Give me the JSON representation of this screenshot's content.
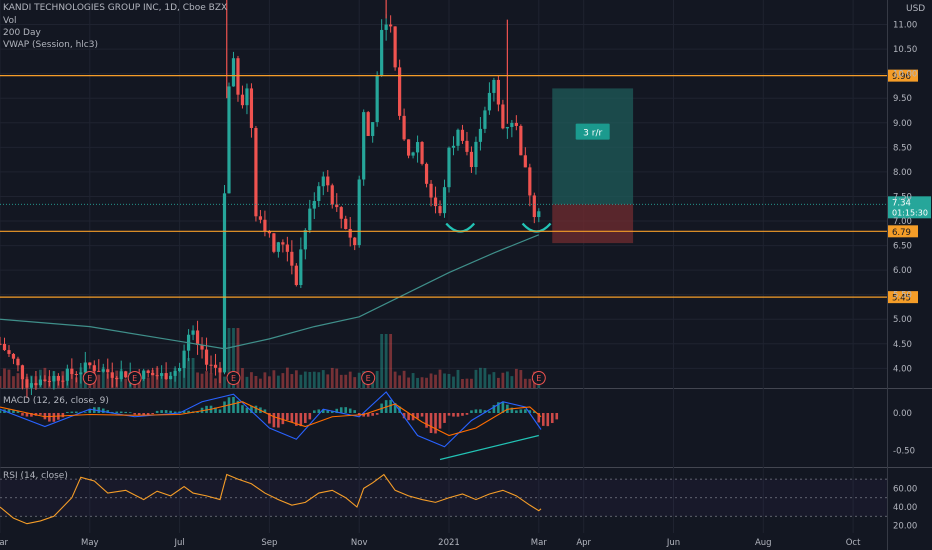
{
  "header": {
    "symbol": "KANDI TECHNOLOGIES GROUP INC, 1D, Cboe BZX",
    "studies": [
      "Vol",
      "200 Day",
      "VWAP (Session, hlc3)"
    ],
    "currency": "USD"
  },
  "colors": {
    "background": "#131722",
    "up": "#26a69a",
    "down": "#ef5350",
    "hline": "#f59d28",
    "ma200": "#3f8f8a",
    "macd": "#2962ff",
    "signal": "#ff6d00",
    "rsi": "#f59d28",
    "profit_zone": "#1f5c59",
    "loss_zone": "#6b2a2f"
  },
  "chart_data": [
    {
      "type": "candlestick",
      "title": "KANDI TECHNOLOGIES GROUP INC, 1D, Cboe BZX",
      "x_labels": [
        "Mar",
        "May",
        "Jul",
        "Sep",
        "Nov",
        "2021",
        "Mar",
        "Apr",
        "Jun",
        "Aug",
        "Oct"
      ],
      "x_label_months": [
        0,
        2,
        4,
        6,
        8,
        10,
        12,
        13,
        15,
        17,
        19
      ],
      "y_ticks": [
        4.0,
        4.5,
        5.0,
        5.5,
        6.0,
        6.5,
        7.0,
        7.5,
        8.0,
        8.5,
        9.0,
        9.5,
        10.0,
        10.5,
        11.0
      ],
      "y_range": [
        3.6,
        11.5
      ],
      "horizontal_levels": [
        {
          "value": 9.96,
          "label": "9.96"
        },
        {
          "value": 6.79,
          "label": "6.79"
        },
        {
          "value": 5.45,
          "label": "5.45"
        }
      ],
      "last_price": {
        "value": 7.34,
        "label": "7.34",
        "countdown": "01:15:30"
      },
      "earnings_markers": [
        "E",
        "E",
        "E",
        "E",
        "E"
      ],
      "earnings_months": [
        2.0,
        3.0,
        5.2,
        8.2,
        12.0
      ],
      "position_tool": {
        "ratio_label": "3 r/r",
        "entry": 7.34,
        "target": 9.7,
        "stop": 6.55,
        "month_start": 12.3,
        "month_end": 14.1
      },
      "price_path": [
        [
          0,
          4.5
        ],
        [
          0.35,
          4.1
        ],
        [
          0.6,
          3.7
        ],
        [
          1.1,
          3.8
        ],
        [
          1.6,
          3.9
        ],
        [
          2.0,
          4.05
        ],
        [
          2.5,
          3.9
        ],
        [
          3.0,
          3.9
        ],
        [
          3.6,
          3.85
        ],
        [
          4.0,
          4.0
        ],
        [
          4.25,
          4.8
        ],
        [
          4.45,
          4.3
        ],
        [
          4.7,
          4.1
        ],
        [
          4.9,
          3.95
        ],
        [
          5.05,
          9.5
        ],
        [
          5.2,
          10.2
        ],
        [
          5.35,
          9.3
        ],
        [
          5.55,
          9.8
        ],
        [
          5.7,
          7.2
        ],
        [
          5.9,
          6.9
        ],
        [
          6.1,
          6.4
        ],
        [
          6.35,
          6.6
        ],
        [
          6.6,
          5.8
        ],
        [
          6.75,
          6.7
        ],
        [
          7.0,
          7.5
        ],
        [
          7.2,
          8.0
        ],
        [
          7.45,
          7.3
        ],
        [
          7.7,
          6.9
        ],
        [
          7.9,
          6.5
        ],
        [
          8.1,
          9.2
        ],
        [
          8.25,
          8.5
        ],
        [
          8.45,
          10.6
        ],
        [
          8.65,
          11.3
        ],
        [
          8.85,
          9.6
        ],
        [
          9.05,
          8.2
        ],
        [
          9.3,
          8.6
        ],
        [
          9.55,
          7.6
        ],
        [
          9.8,
          7.1
        ],
        [
          10.0,
          8.4
        ],
        [
          10.25,
          8.9
        ],
        [
          10.5,
          8.1
        ],
        [
          10.75,
          9.2
        ],
        [
          11.0,
          9.8
        ],
        [
          11.2,
          8.9
        ],
        [
          11.45,
          9.1
        ],
        [
          11.7,
          8.0
        ],
        [
          11.9,
          7.2
        ],
        [
          12.05,
          7.34
        ]
      ],
      "ma200_path": [
        [
          0,
          5.0
        ],
        [
          2.0,
          4.85
        ],
        [
          4.0,
          4.55
        ],
        [
          5.0,
          4.4
        ],
        [
          6.0,
          4.6
        ],
        [
          7.0,
          4.85
        ],
        [
          8.0,
          5.05
        ],
        [
          9.0,
          5.5
        ],
        [
          10.0,
          5.95
        ],
        [
          11.0,
          6.35
        ],
        [
          12.0,
          6.72
        ]
      ],
      "annotations": [
        {
          "type": "arc",
          "month": 10.25,
          "value": 6.95
        },
        {
          "type": "arc",
          "month": 11.95,
          "value": 6.95
        }
      ]
    },
    {
      "type": "histogram",
      "title": "MACD (12, 26, close, 9)",
      "y_ticks": [
        0.0,
        -0.5
      ],
      "y_range": [
        -0.72,
        0.32
      ],
      "histogram": [
        [
          0,
          0.05
        ],
        [
          0.5,
          -0.05
        ],
        [
          1.0,
          -0.12
        ],
        [
          1.5,
          0.02
        ],
        [
          2.0,
          0.08
        ],
        [
          2.5,
          0.02
        ],
        [
          3.0,
          -0.03
        ],
        [
          3.5,
          0.04
        ],
        [
          4.0,
          0.03
        ],
        [
          4.5,
          0.1
        ],
        [
          5.0,
          0.22
        ],
        [
          5.5,
          0.1
        ],
        [
          6.0,
          -0.2
        ],
        [
          6.5,
          -0.18
        ],
        [
          7.0,
          0.05
        ],
        [
          7.5,
          0.08
        ],
        [
          8.0,
          -0.05
        ],
        [
          8.5,
          0.18
        ],
        [
          9.0,
          -0.1
        ],
        [
          9.5,
          -0.28
        ],
        [
          10.0,
          -0.05
        ],
        [
          10.5,
          0.05
        ],
        [
          11.0,
          0.15
        ],
        [
          11.5,
          0.05
        ],
        [
          12.0,
          -0.18
        ]
      ],
      "macd_line": [
        [
          0,
          0.05
        ],
        [
          1,
          -0.18
        ],
        [
          2,
          0.05
        ],
        [
          3,
          -0.05
        ],
        [
          4,
          0.0
        ],
        [
          4.5,
          0.15
        ],
        [
          5.2,
          0.25
        ],
        [
          6.0,
          -0.2
        ],
        [
          6.6,
          -0.35
        ],
        [
          7.2,
          0.05
        ],
        [
          8.0,
          -0.05
        ],
        [
          8.6,
          0.28
        ],
        [
          9.3,
          -0.3
        ],
        [
          9.9,
          -0.45
        ],
        [
          10.5,
          -0.1
        ],
        [
          11.2,
          0.15
        ],
        [
          11.7,
          0.08
        ],
        [
          12.05,
          -0.22
        ]
      ],
      "signal_line": [
        [
          0,
          0.08
        ],
        [
          1,
          -0.05
        ],
        [
          2,
          -0.02
        ],
        [
          3,
          -0.03
        ],
        [
          4,
          -0.02
        ],
        [
          4.7,
          0.05
        ],
        [
          5.4,
          0.15
        ],
        [
          6.1,
          -0.05
        ],
        [
          6.8,
          -0.18
        ],
        [
          7.4,
          -0.05
        ],
        [
          8.1,
          -0.02
        ],
        [
          8.8,
          0.12
        ],
        [
          9.4,
          -0.12
        ],
        [
          10.0,
          -0.3
        ],
        [
          10.6,
          -0.2
        ],
        [
          11.3,
          0.05
        ],
        [
          11.8,
          0.08
        ],
        [
          12.05,
          -0.05
        ]
      ],
      "divergence_line": [
        [
          9.8,
          -0.62
        ],
        [
          12.0,
          -0.3
        ]
      ]
    },
    {
      "type": "line",
      "title": "RSI (14, close)",
      "y_ticks": [
        60.0,
        40.0,
        20.0
      ],
      "y_range": [
        12,
        82
      ],
      "band": [
        30,
        70
      ],
      "mid": 50,
      "values": [
        [
          0,
          40
        ],
        [
          0.3,
          28
        ],
        [
          0.6,
          22
        ],
        [
          0.9,
          25
        ],
        [
          1.2,
          30
        ],
        [
          1.6,
          50
        ],
        [
          1.8,
          72
        ],
        [
          2.1,
          68
        ],
        [
          2.4,
          55
        ],
        [
          2.8,
          58
        ],
        [
          3.2,
          48
        ],
        [
          3.5,
          57
        ],
        [
          3.8,
          52
        ],
        [
          4.1,
          62
        ],
        [
          4.3,
          55
        ],
        [
          4.6,
          52
        ],
        [
          4.9,
          48
        ],
        [
          5.05,
          75
        ],
        [
          5.3,
          70
        ],
        [
          5.6,
          65
        ],
        [
          5.9,
          55
        ],
        [
          6.2,
          48
        ],
        [
          6.5,
          42
        ],
        [
          6.8,
          45
        ],
        [
          7.1,
          55
        ],
        [
          7.4,
          58
        ],
        [
          7.7,
          50
        ],
        [
          7.95,
          40
        ],
        [
          8.1,
          60
        ],
        [
          8.3,
          66
        ],
        [
          8.55,
          75
        ],
        [
          8.8,
          58
        ],
        [
          9.1,
          52
        ],
        [
          9.4,
          48
        ],
        [
          9.7,
          45
        ],
        [
          10.0,
          50
        ],
        [
          10.3,
          54
        ],
        [
          10.6,
          48
        ],
        [
          10.9,
          54
        ],
        [
          11.2,
          58
        ],
        [
          11.5,
          52
        ],
        [
          11.8,
          42
        ],
        [
          12.0,
          36
        ],
        [
          12.05,
          38
        ]
      ]
    }
  ]
}
